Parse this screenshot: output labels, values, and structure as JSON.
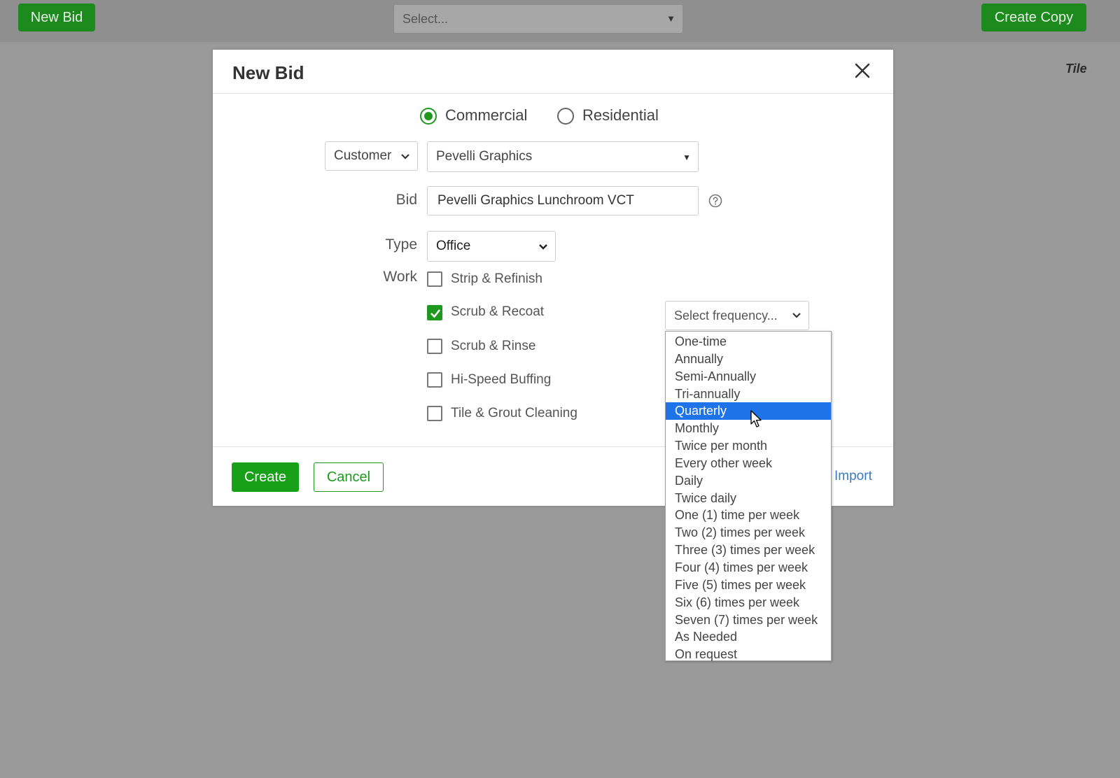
{
  "topbar": {
    "new_bid_label": "New Bid",
    "select_placeholder": "Select...",
    "create_copy_label": "Create Copy",
    "tile_label": "Tile"
  },
  "modal": {
    "title": "New Bid",
    "radio": {
      "commercial": "Commercial",
      "residential": "Residential",
      "selected": "Commercial"
    },
    "party_type": "Customer",
    "customer": "Pevelli Graphics",
    "bid_label": "Bid",
    "bid_value": "Pevelli Graphics Lunchroom VCT",
    "type_label": "Type",
    "type_value": "Office",
    "work_label": "Work",
    "work_items": [
      {
        "label": "Strip & Refinish",
        "checked": false
      },
      {
        "label": "Scrub & Recoat",
        "checked": true
      },
      {
        "label": "Scrub & Rinse",
        "checked": false
      },
      {
        "label": "Hi-Speed Buffing",
        "checked": false
      },
      {
        "label": "Tile & Grout Cleaning",
        "checked": false
      }
    ],
    "frequency_placeholder": "Select frequency...",
    "frequency_options": [
      "One-time",
      "Annually",
      "Semi-Annually",
      "Tri-annually",
      "Quarterly",
      "Monthly",
      "Twice per month",
      "Every other week",
      "Daily",
      "Twice daily",
      "One (1) time per week",
      "Two (2) times per week",
      "Three (3) times per week",
      "Four (4) times per week",
      "Five (5) times per week",
      "Six (6) times per week",
      "Seven (7) times per week",
      "As Needed",
      "On request"
    ],
    "frequency_highlighted": "Quarterly",
    "create_label": "Create",
    "cancel_label": "Cancel",
    "import_label": "Import"
  },
  "colors": {
    "primary_green": "#19a019",
    "highlight_blue": "#1e73e8",
    "link_blue": "#3a7bbf"
  }
}
